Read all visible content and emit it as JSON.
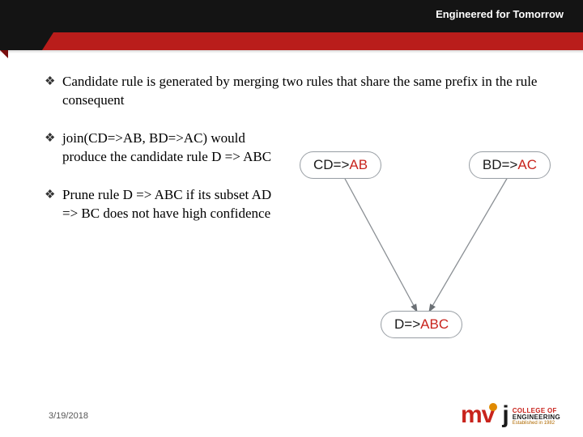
{
  "header": {
    "tagline": "Engineered for Tomorrow"
  },
  "bullets": {
    "b1": "Candidate rule is generated by merging two rules that share the same prefix in the rule consequent",
    "b2": "join(CD=>AB, BD=>AC) would produce the candidate rule D => ABC",
    "b3": "Prune rule D => ABC if its subset AD => BC does not have high confidence"
  },
  "diagram": {
    "node_left": {
      "lhs": "CD=>",
      "rhs": "AB"
    },
    "node_right": {
      "lhs": "BD=>",
      "rhs": "AC"
    },
    "node_bottom": {
      "lhs": "D=>",
      "rhs": "ABC"
    }
  },
  "footer": {
    "date": "3/19/2018"
  },
  "logo": {
    "mv": "mv",
    "j": "j",
    "line1": "COLLEGE OF",
    "line2": "ENGINEERING",
    "est": "Established in 1982"
  }
}
